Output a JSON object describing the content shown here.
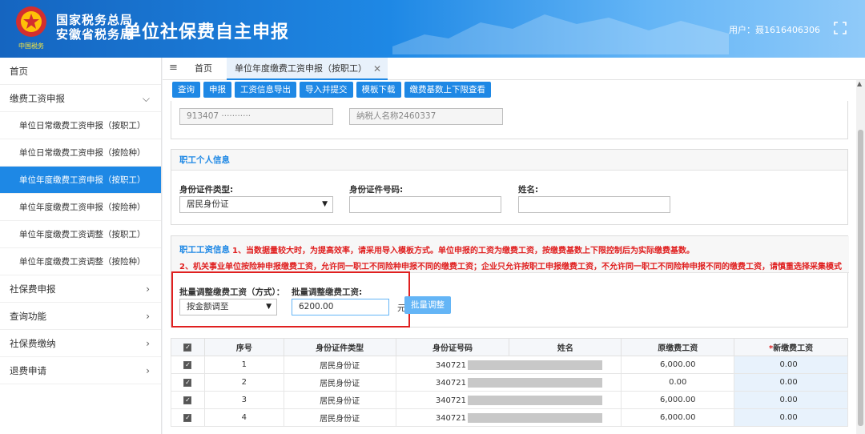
{
  "header": {
    "bureau_line1": "国家税务总局",
    "bureau_line2": "安徽省税务局",
    "title": "单位社保费自主申报",
    "user_label": "用户：聂1616406306"
  },
  "sidebar": {
    "items": [
      {
        "label": "首页",
        "kind": "top"
      },
      {
        "label": "缴费工资申报",
        "kind": "top",
        "chev": "⌵"
      },
      {
        "label": "单位日常缴费工资申报（按职工）",
        "kind": "sub"
      },
      {
        "label": "单位日常缴费工资申报（按险种）",
        "kind": "sub"
      },
      {
        "label": "单位年度缴费工资申报（按职工）",
        "kind": "sub",
        "active": true
      },
      {
        "label": "单位年度缴费工资申报（按险种）",
        "kind": "sub"
      },
      {
        "label": "单位年度缴费工资调整（按职工）",
        "kind": "sub"
      },
      {
        "label": "单位年度缴费工资调整（按险种）",
        "kind": "sub"
      },
      {
        "label": "社保费申报",
        "kind": "top",
        "chev": "›"
      },
      {
        "label": "查询功能",
        "kind": "top",
        "chev": "›"
      },
      {
        "label": "社保费缴纳",
        "kind": "top",
        "chev": "›"
      },
      {
        "label": "退费申请",
        "kind": "top",
        "chev": "›"
      }
    ]
  },
  "tabs": {
    "menu": "≡",
    "home": "首页",
    "current": "单位年度缴费工资申报（按职工）",
    "close": "✕"
  },
  "toolbar": {
    "buttons": [
      "查询",
      "申报",
      "工资信息导出",
      "导入并提交",
      "模板下载",
      "缴费基数上下限查看"
    ]
  },
  "taxpayer": {
    "id_value": "913407 ···········",
    "name_value": "纳税人名称2460337"
  },
  "personal": {
    "title": "职工个人信息",
    "id_type_label": "身份证件类型:",
    "id_type_value": "居民身份证",
    "id_no_label": "身份证件号码:",
    "name_label": "姓名:"
  },
  "wage": {
    "title": "职工工资信息",
    "notice1": "1、当数据量较大时，为提高效率，请采用导入模板方式。单位申报的工资为缴费工资，按缴费基数上下限控制后为实际缴费基数。",
    "notice2": "2、机关事业单位按险种申报缴费工资，允许同一职工不同险种申报不同的缴费工资；企业只允许按职工申报缴费工资，不允许同一职工不同险种申报不同的缴费工资，请慎重选择采集模式",
    "batch_mode_label": "批量调整缴费工资（方式）：",
    "batch_mode_value": "按金额调至",
    "batch_value_label": "批量调整缴费工资:",
    "batch_value": "6200.00",
    "unit": "元",
    "adjust_button": "批量调整"
  },
  "table": {
    "headers": [
      "序号",
      "身份证件类型",
      "身份证号码",
      "姓名",
      "原缴费工资",
      "新缴费工资"
    ],
    "required_mark": "*",
    "rows": [
      {
        "no": "1",
        "id_type": "居民身份证",
        "id_prefix": "340721",
        "name": "",
        "old": "6,000.00",
        "new": "0.00"
      },
      {
        "no": "2",
        "id_type": "居民身份证",
        "id_prefix": "340721",
        "name": "",
        "old": "0.00",
        "new": "0.00"
      },
      {
        "no": "3",
        "id_type": "居民身份证",
        "id_prefix": "340721",
        "name": "",
        "old": "6,000.00",
        "new": "0.00"
      },
      {
        "no": "4",
        "id_type": "居民身份证",
        "id_prefix": "340721",
        "name": "",
        "old": "6,000.00",
        "new": "0.00"
      }
    ]
  },
  "colors": {
    "primary": "#1e88e5",
    "notice": "#e02020",
    "active_nav": "#1e88e5"
  },
  "icons": {
    "emblem": "tax-emblem-icon",
    "fullscreen": "fullscreen-icon"
  }
}
